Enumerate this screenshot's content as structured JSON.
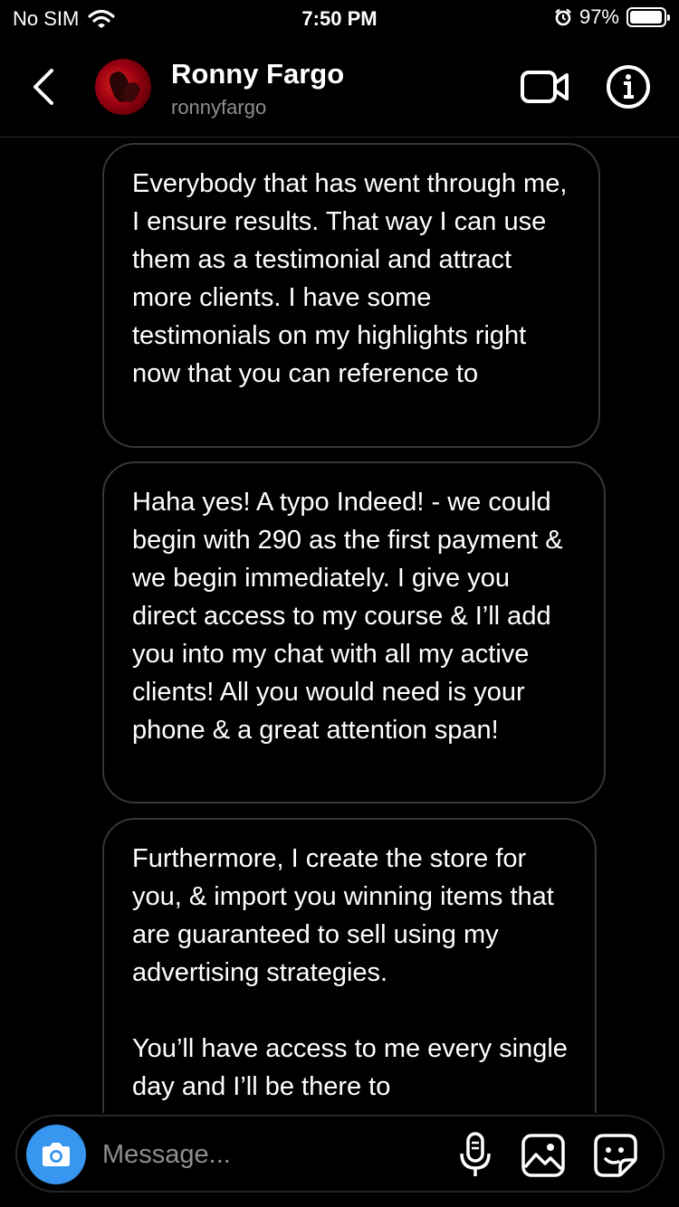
{
  "status_bar": {
    "carrier": "No SIM",
    "time": "7:50 PM",
    "battery": "97%",
    "battery_level": 0.97
  },
  "header": {
    "name": "Ronny Fargo",
    "username": "ronnyfargo"
  },
  "messages": [
    {
      "text": "Everybody that has went through me, I ensure results. That way I can use them as a testimonial and attract more clients. I have some testimonials on my highlights right now that you can reference to"
    },
    {
      "text": "Haha yes! A typo Indeed! - we could begin with 290 as the first payment & we begin immediately. I give you direct access to my course & I’ll add you into my chat with all my active clients! All you would need is your phone & a great attention span!"
    },
    {
      "text": "Furthermore, I create the store for you, & import you winning items that are guaranteed to sell using my advertising strategies.\n\nYou’ll have access to me every single day and I’ll be there to"
    }
  ],
  "composer": {
    "placeholder": "Message..."
  },
  "colors": {
    "background": "#000000",
    "accent": "#3797f0",
    "bubble_border": "#363636",
    "secondary_text": "#8e8e8e"
  }
}
